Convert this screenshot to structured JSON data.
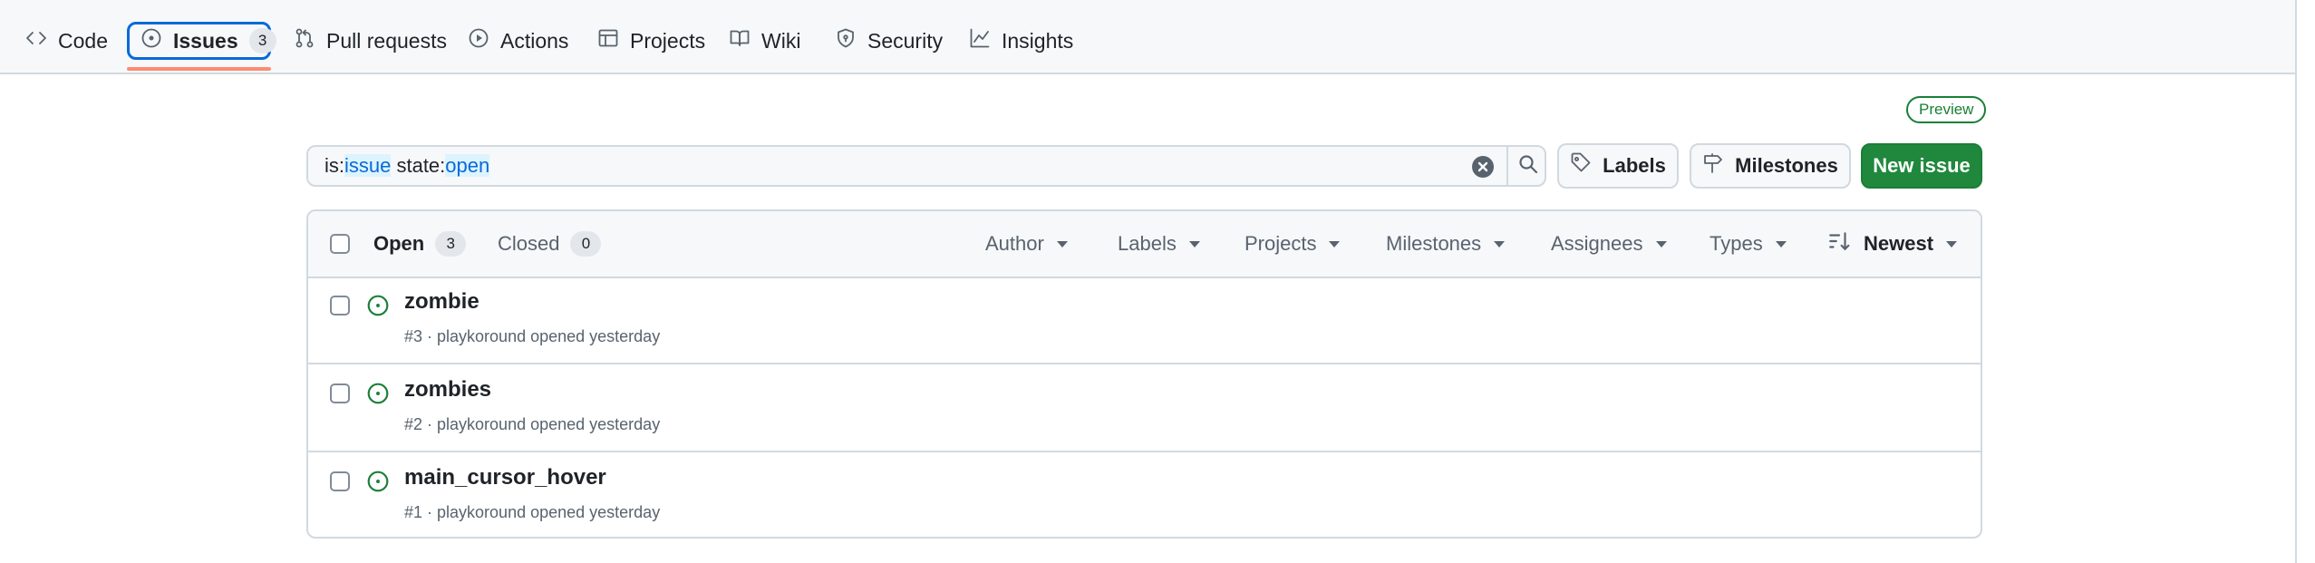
{
  "repo_nav": {
    "tabs": [
      {
        "label": "Code",
        "icon": "code-icon"
      },
      {
        "label": "Issues",
        "icon": "issue-opened-icon",
        "count": "3",
        "active": true
      },
      {
        "label": "Pull requests",
        "icon": "git-pull-request-icon"
      },
      {
        "label": "Actions",
        "icon": "play-icon"
      },
      {
        "label": "Projects",
        "icon": "table-icon"
      },
      {
        "label": "Wiki",
        "icon": "book-icon"
      },
      {
        "label": "Security",
        "icon": "shield-icon"
      },
      {
        "label": "Insights",
        "icon": "graph-icon"
      }
    ]
  },
  "preview_badge": "Preview",
  "search": {
    "prefix1": "is:",
    "token1": "issue",
    "prefix2": " state:",
    "token2": "open"
  },
  "buttons": {
    "labels": "Labels",
    "milestones": "Milestones",
    "new_issue": "New issue"
  },
  "list_header": {
    "open_label": "Open",
    "open_count": "3",
    "closed_label": "Closed",
    "closed_count": "0",
    "filters": [
      "Author",
      "Labels",
      "Projects",
      "Milestones",
      "Assignees",
      "Types"
    ],
    "sort": "Newest"
  },
  "issues": [
    {
      "title": "zombie",
      "meta": "#3 · playkoround opened yesterday",
      "state": "open"
    },
    {
      "title": "zombies",
      "meta": "#2 · playkoround opened yesterday",
      "state": "open"
    },
    {
      "title": "main_cursor_hover",
      "meta": "#1 · playkoround opened yesterday",
      "state": "open"
    }
  ],
  "colors": {
    "accent": "#0969da",
    "open_green": "#1a7f37",
    "primary_button": "#1f883d",
    "tab_underline": "#fd8c73"
  }
}
